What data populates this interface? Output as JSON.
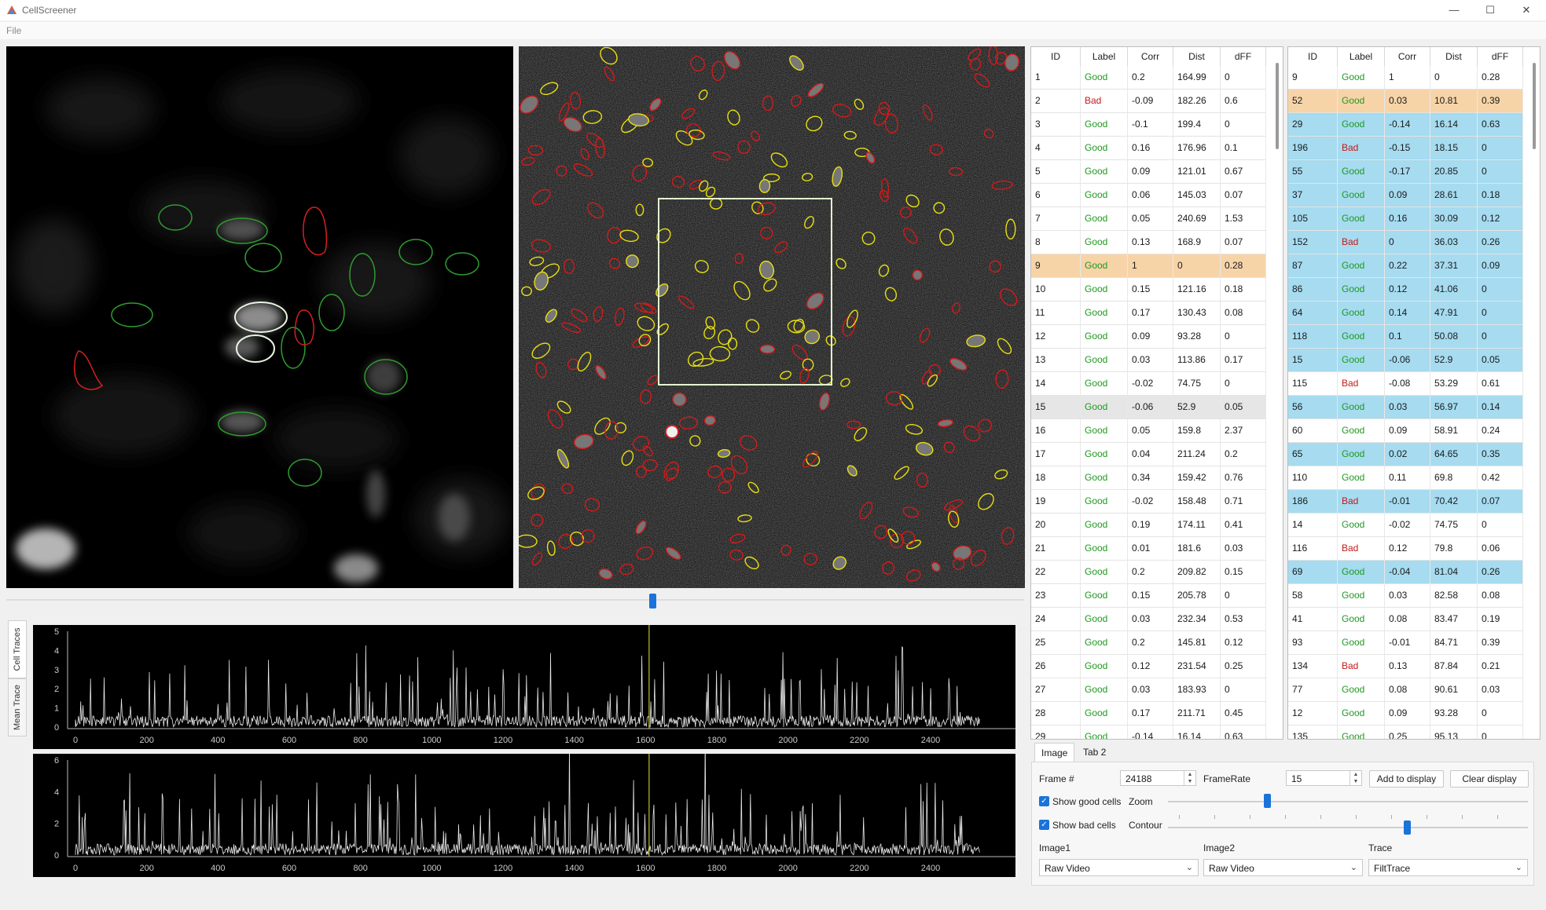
{
  "app": {
    "title": "CellScreener"
  },
  "window_controls": {
    "minimize": "—",
    "maximize": "☐",
    "close": "✕"
  },
  "menu": {
    "file": "File"
  },
  "trace_tabs": [
    "Cell Traces",
    "Mean Trace"
  ],
  "trace_plots": [
    {
      "ticks_x": [
        "0",
        "200",
        "400",
        "600",
        "800",
        "1000",
        "1200",
        "1400",
        "1600",
        "1800",
        "2000",
        "2200",
        "2400"
      ],
      "ticks_y": [
        "0",
        "1",
        "2",
        "3",
        "4",
        "5"
      ],
      "cursor": 1610
    },
    {
      "ticks_x": [
        "0",
        "200",
        "400",
        "600",
        "800",
        "1000",
        "1200",
        "1400",
        "1600",
        "1800",
        "2000",
        "2200",
        "2400"
      ],
      "ticks_y": [
        "0",
        "2",
        "4",
        "6"
      ],
      "cursor": 1610
    }
  ],
  "table_columns": [
    "ID",
    "Label",
    "Corr",
    "Dist",
    "dFF"
  ],
  "table_left": [
    [
      "1",
      "Good",
      "0.2",
      "164.99",
      "0"
    ],
    [
      "2",
      "Bad",
      "-0.09",
      "182.26",
      "0.6"
    ],
    [
      "3",
      "Good",
      "-0.1",
      "199.4",
      "0"
    ],
    [
      "4",
      "Good",
      "0.16",
      "176.96",
      "0.1"
    ],
    [
      "5",
      "Good",
      "0.09",
      "121.01",
      "0.67"
    ],
    [
      "6",
      "Good",
      "0.06",
      "145.03",
      "0.07"
    ],
    [
      "7",
      "Good",
      "0.05",
      "240.69",
      "1.53"
    ],
    [
      "8",
      "Good",
      "0.13",
      "168.9",
      "0.07"
    ],
    [
      "9",
      "Good",
      "1",
      "0",
      "0.28"
    ],
    [
      "10",
      "Good",
      "0.15",
      "121.16",
      "0.18"
    ],
    [
      "11",
      "Good",
      "0.17",
      "130.43",
      "0.08"
    ],
    [
      "12",
      "Good",
      "0.09",
      "93.28",
      "0"
    ],
    [
      "13",
      "Good",
      "0.03",
      "113.86",
      "0.17"
    ],
    [
      "14",
      "Good",
      "-0.02",
      "74.75",
      "0"
    ],
    [
      "15",
      "Good",
      "-0.06",
      "52.9",
      "0.05"
    ],
    [
      "16",
      "Good",
      "0.05",
      "159.8",
      "2.37"
    ],
    [
      "17",
      "Good",
      "0.04",
      "211.24",
      "0.2"
    ],
    [
      "18",
      "Good",
      "0.34",
      "159.42",
      "0.76"
    ],
    [
      "19",
      "Good",
      "-0.02",
      "158.48",
      "0.71"
    ],
    [
      "20",
      "Good",
      "0.19",
      "174.11",
      "0.41"
    ],
    [
      "21",
      "Good",
      "0.01",
      "181.6",
      "0.03"
    ],
    [
      "22",
      "Good",
      "0.2",
      "209.82",
      "0.15"
    ],
    [
      "23",
      "Good",
      "0.15",
      "205.78",
      "0"
    ],
    [
      "24",
      "Good",
      "0.03",
      "232.34",
      "0.53"
    ],
    [
      "25",
      "Good",
      "0.2",
      "145.81",
      "0.12"
    ],
    [
      "26",
      "Good",
      "0.12",
      "231.54",
      "0.25"
    ],
    [
      "27",
      "Good",
      "0.03",
      "183.93",
      "0"
    ],
    [
      "28",
      "Good",
      "0.17",
      "211.71",
      "0.45"
    ],
    [
      "29",
      "Good",
      "-0.14",
      "16.14",
      "0.63"
    ]
  ],
  "table_right": [
    [
      "9",
      "Good",
      "1",
      "0",
      "0.28"
    ],
    [
      "52",
      "Good",
      "0.03",
      "10.81",
      "0.39"
    ],
    [
      "29",
      "Good",
      "-0.14",
      "16.14",
      "0.63"
    ],
    [
      "196",
      "Bad",
      "-0.15",
      "18.15",
      "0"
    ],
    [
      "55",
      "Good",
      "-0.17",
      "20.85",
      "0"
    ],
    [
      "37",
      "Good",
      "0.09",
      "28.61",
      "0.18"
    ],
    [
      "105",
      "Good",
      "0.16",
      "30.09",
      "0.12"
    ],
    [
      "152",
      "Bad",
      "0",
      "36.03",
      "0.26"
    ],
    [
      "87",
      "Good",
      "0.22",
      "37.31",
      "0.09"
    ],
    [
      "86",
      "Good",
      "0.12",
      "41.06",
      "0"
    ],
    [
      "64",
      "Good",
      "0.14",
      "47.91",
      "0"
    ],
    [
      "118",
      "Good",
      "0.1",
      "50.08",
      "0"
    ],
    [
      "15",
      "Good",
      "-0.06",
      "52.9",
      "0.05"
    ],
    [
      "115",
      "Bad",
      "-0.08",
      "53.29",
      "0.61"
    ],
    [
      "56",
      "Good",
      "0.03",
      "56.97",
      "0.14"
    ],
    [
      "60",
      "Good",
      "0.09",
      "58.91",
      "0.24"
    ],
    [
      "65",
      "Good",
      "0.02",
      "64.65",
      "0.35"
    ],
    [
      "110",
      "Good",
      "0.11",
      "69.8",
      "0.42"
    ],
    [
      "186",
      "Bad",
      "-0.01",
      "70.42",
      "0.07"
    ],
    [
      "14",
      "Good",
      "-0.02",
      "74.75",
      "0"
    ],
    [
      "116",
      "Bad",
      "0.12",
      "79.8",
      "0.06"
    ],
    [
      "69",
      "Good",
      "-0.04",
      "81.04",
      "0.26"
    ],
    [
      "58",
      "Good",
      "0.03",
      "82.58",
      "0.08"
    ],
    [
      "41",
      "Good",
      "0.08",
      "83.47",
      "0.19"
    ],
    [
      "93",
      "Good",
      "-0.01",
      "84.71",
      "0.39"
    ],
    [
      "134",
      "Bad",
      "0.13",
      "87.84",
      "0.21"
    ],
    [
      "77",
      "Good",
      "0.08",
      "90.61",
      "0.03"
    ],
    [
      "12",
      "Good",
      "0.09",
      "93.28",
      "0"
    ],
    [
      "135",
      "Good",
      "0.25",
      "95.13",
      "0"
    ]
  ],
  "right_row_bg": [
    "white",
    "orange",
    "blue",
    "blue",
    "blue",
    "blue",
    "blue",
    "blue",
    "blue",
    "blue",
    "blue",
    "blue",
    "blue",
    "white",
    "blue",
    "white",
    "blue",
    "white",
    "blue",
    "white",
    "white",
    "blue",
    "white",
    "white",
    "white",
    "white",
    "white",
    "white",
    "white"
  ],
  "left_row_bg": [
    "white",
    "white",
    "white",
    "white",
    "white",
    "white",
    "white",
    "white",
    "orange",
    "white",
    "white",
    "white",
    "white",
    "white",
    "gray",
    "white",
    "white",
    "white",
    "white",
    "white",
    "white",
    "white",
    "white",
    "white",
    "white",
    "white",
    "white",
    "white",
    "white"
  ],
  "colors": {
    "good": "#1f9a1f",
    "bad": "#c41a1a",
    "selected": "#f7d4a8",
    "neighbor": "#a6dbf0",
    "current": "#e6e6e6",
    "accent": "#1a73d9"
  },
  "controls": {
    "tabs": [
      "Image",
      "Tab 2"
    ],
    "frame_label": "Frame #",
    "frame_value": "24188",
    "framerate_label": "FrameRate",
    "framerate_value": "15",
    "add_button": "Add to display",
    "clear_button": "Clear display",
    "show_good": "Show good cells",
    "show_bad": "Show bad cells",
    "zoom_label": "Zoom",
    "contour_label": "Contour",
    "image1_label": "Image1",
    "image2_label": "Image2",
    "trace_label": "Trace",
    "image1_value": "Raw Video",
    "image2_value": "Raw Video",
    "trace_value": "FiltTrace"
  }
}
